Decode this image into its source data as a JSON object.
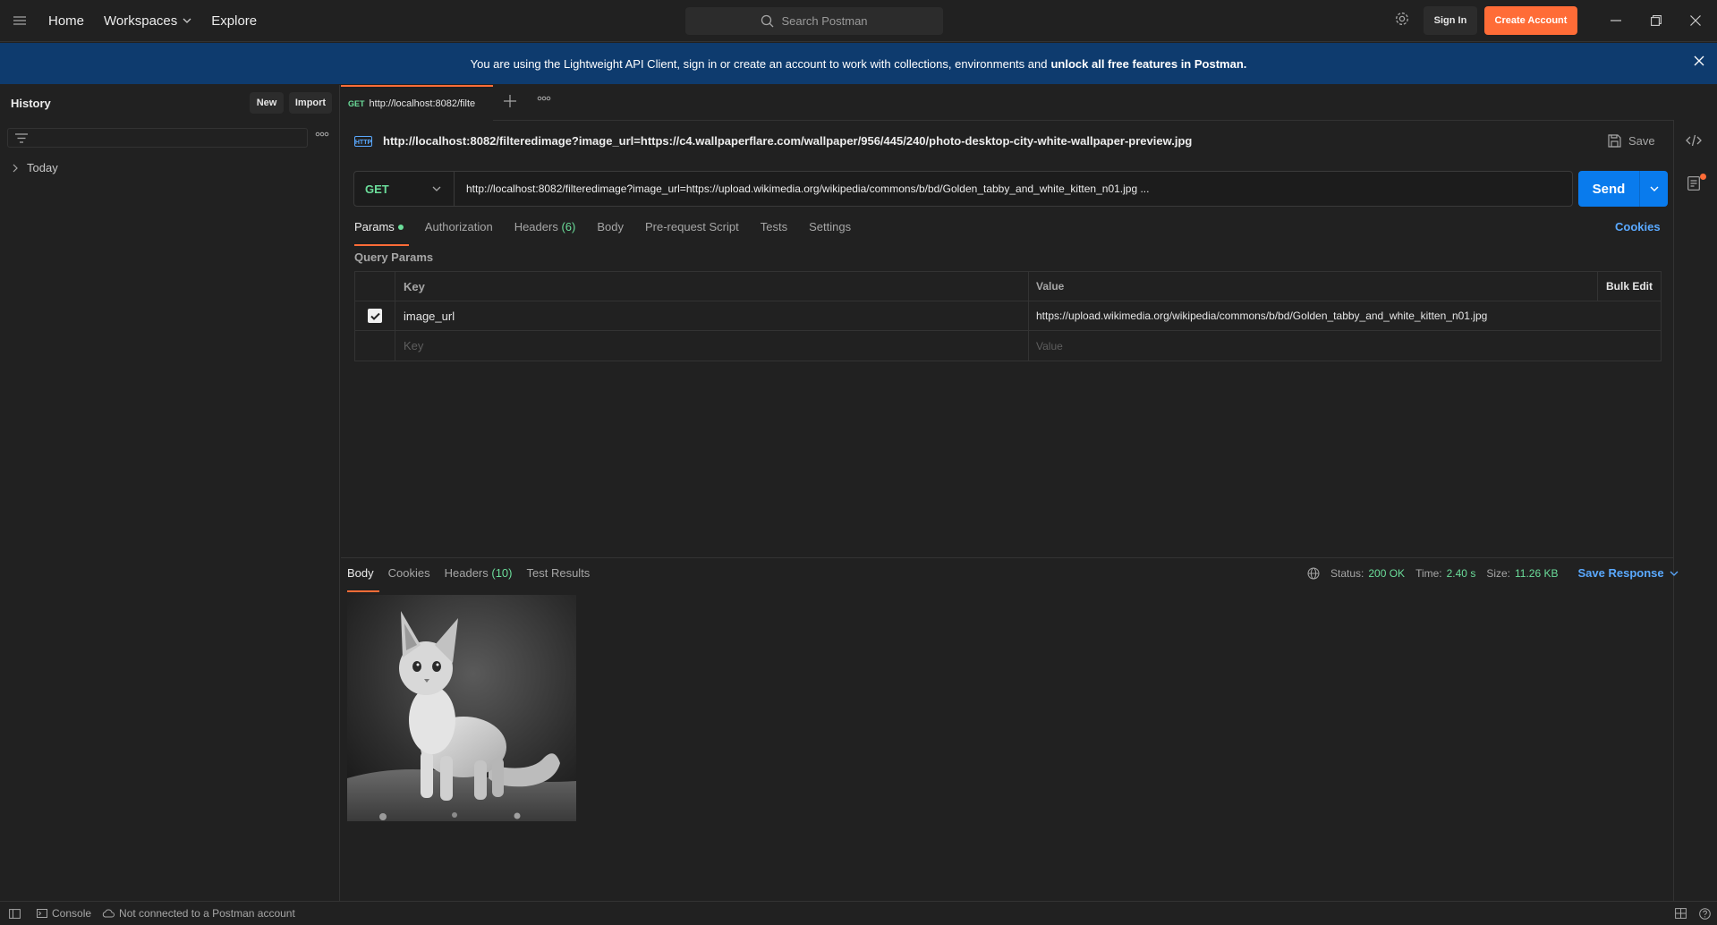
{
  "topbar": {
    "nav": [
      "Home",
      "Workspaces",
      "Explore"
    ],
    "search_placeholder": "Search Postman",
    "sign_in": "Sign In",
    "create_account": "Create Account"
  },
  "banner": {
    "text": "You are using the Lightweight API Client, sign in or create an account to work with collections, environments and",
    "bold": "unlock all free features in Postman."
  },
  "sidebar": {
    "title": "History",
    "new_label": "New",
    "import_label": "Import",
    "groups": [
      "Today"
    ]
  },
  "tab": {
    "method": "GET",
    "url": "http://localhost:8082/filte"
  },
  "request": {
    "name": "http://localhost:8082/filteredimage?image_url=https://c4.wallpaperflare.com/wallpaper/956/445/240/photo-desktop-city-white-wallpaper-preview.jpg",
    "save_label": "Save",
    "method": "GET",
    "url": "http://localhost:8082/filteredimage?image_url=https://upload.wikimedia.org/wikipedia/commons/b/bd/Golden_tabby_and_white_kitten_n01.jpg ...",
    "send_label": "Send",
    "tabs": {
      "params": "Params",
      "authorization": "Authorization",
      "headers": "Headers",
      "headers_count": "(6)",
      "body": "Body",
      "prerequest": "Pre-request Script",
      "tests": "Tests",
      "settings": "Settings"
    },
    "cookies": "Cookies",
    "query_params_title": "Query Params",
    "params_table": {
      "col_key": "Key",
      "col_value": "Value",
      "bulk_edit": "Bulk Edit",
      "rows": [
        {
          "key": "image_url",
          "value": "https://upload.wikimedia.org/wikipedia/commons/b/bd/Golden_tabby_and_white_kitten_n01.jpg",
          "checked": true
        }
      ],
      "key_placeholder": "Key",
      "value_placeholder": "Value"
    }
  },
  "response": {
    "tabs": {
      "body": "Body",
      "cookies": "Cookies",
      "headers": "Headers",
      "headers_count": "(10)",
      "test_results": "Test Results"
    },
    "status_label": "Status:",
    "status": "200 OK",
    "time_label": "Time:",
    "time": "2.40 s",
    "size_label": "Size:",
    "size": "11.26 KB",
    "save_response": "Save Response"
  },
  "footer": {
    "console": "Console",
    "connection": "Not connected to a Postman account"
  },
  "colors": {
    "accent": "#ff6c37",
    "send": "#097bed",
    "method_get": "#6bdd9a",
    "banner": "#0e3b6e"
  }
}
